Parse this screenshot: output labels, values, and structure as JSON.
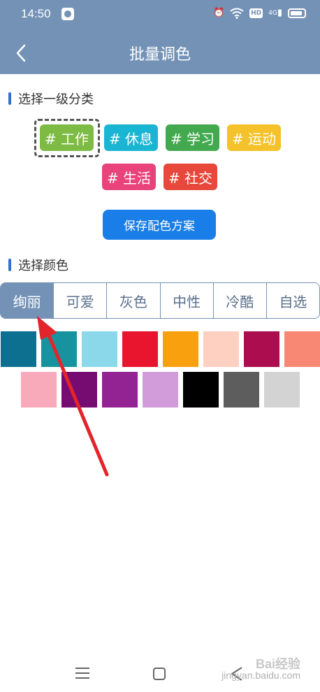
{
  "status_bar": {
    "time": "14:50",
    "hd": "HD",
    "network": "4G"
  },
  "header": {
    "title": "批量调色"
  },
  "section1": {
    "label": "选择一级分类"
  },
  "tags": [
    {
      "label": "# 工作",
      "color": "#7dbb45",
      "selected": true
    },
    {
      "label": "# 休息",
      "color": "#1ab5d3"
    },
    {
      "label": "# 学习",
      "color": "#43a94e"
    },
    {
      "label": "# 运动",
      "color": "#f5c22b"
    },
    {
      "label": "# 生活",
      "color": "#e8437b"
    },
    {
      "label": "# 社交",
      "color": "#e8483c"
    }
  ],
  "save_button": {
    "label": "保存配色方案"
  },
  "section2": {
    "label": "选择颜色"
  },
  "tabs": [
    {
      "label": "绚丽",
      "active": true
    },
    {
      "label": "可爱"
    },
    {
      "label": "灰色"
    },
    {
      "label": "中性"
    },
    {
      "label": "冷酷"
    },
    {
      "label": "自选"
    }
  ],
  "swatches_row1": [
    "#0e7091",
    "#17939f",
    "#8ad8ea",
    "#e9142d",
    "#f9a00f",
    "#fdd0c1",
    "#ab0d4e",
    "#f88874"
  ],
  "swatches_row2": [
    "#f8aabb",
    "#760c72",
    "#932292",
    "#d19cd9",
    "#000000",
    "#5d5d5d",
    "#d3d3d3"
  ],
  "watermark": {
    "line1": "Bai经验",
    "line2": "jingyan.baidu.com"
  }
}
